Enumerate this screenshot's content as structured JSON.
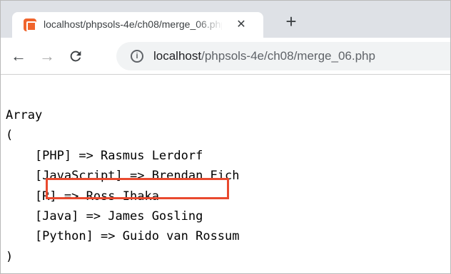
{
  "tab": {
    "title": "localhost/phpsols-4e/ch08/merge_06.php",
    "close_glyph": "✕",
    "favicon": "xampp-icon"
  },
  "toolbar": {
    "new_tab_glyph": "+",
    "back_glyph": "←",
    "forward_glyph": "→",
    "reload_glyph": "C",
    "info_glyph": "i",
    "url_host": "localhost",
    "url_path": "/phpsols-4e/ch08/merge_06.php"
  },
  "output": {
    "lines": [
      "Array",
      "(",
      "    [PHP] => Rasmus Lerdorf",
      "    [JavaScript] => Brendan Eich",
      "    [R] => Ross Ihaka",
      "    [Java] => James Gosling",
      "    [Python] => Guido van Rossum",
      ")"
    ],
    "highlighted_line_index": 4,
    "highlight_color": "#e9492e"
  },
  "colors": {
    "tabstrip": "#dee1e6",
    "omnibox": "#f1f3f4"
  }
}
